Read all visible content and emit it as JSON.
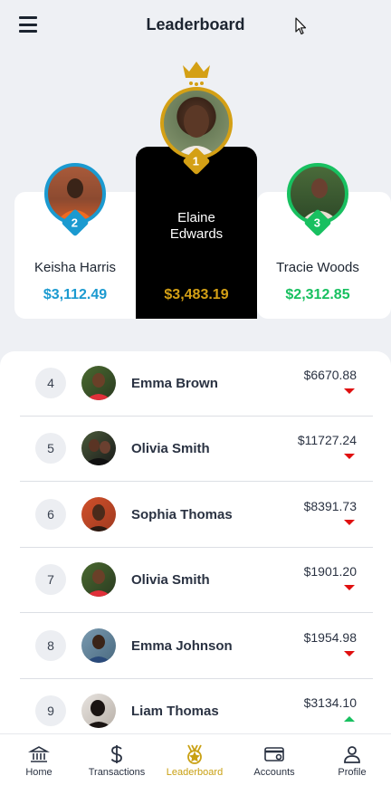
{
  "header": {
    "title": "Leaderboard"
  },
  "podium": {
    "first": {
      "rank": "1",
      "name_line1": "Elaine",
      "name_line2": "Edwards",
      "amount": "$3,483.19",
      "color": "#d4a015"
    },
    "second": {
      "rank": "2",
      "name": "Keisha Harris",
      "amount": "$3,112.49",
      "color": "#1b9ad0"
    },
    "third": {
      "rank": "3",
      "name": "Tracie Woods",
      "amount": "$2,312.85",
      "color": "#18c060"
    }
  },
  "list": [
    {
      "rank": "4",
      "name": "Emma Brown",
      "amount": "$6670.88",
      "trend": "down"
    },
    {
      "rank": "5",
      "name": "Olivia Smith",
      "amount": "$11727.24",
      "trend": "down"
    },
    {
      "rank": "6",
      "name": "Sophia Thomas",
      "amount": "$8391.73",
      "trend": "down"
    },
    {
      "rank": "7",
      "name": "Olivia Smith",
      "amount": "$1901.20",
      "trend": "down"
    },
    {
      "rank": "8",
      "name": "Emma Johnson",
      "amount": "$1954.98",
      "trend": "down"
    },
    {
      "rank": "9",
      "name": "Liam Thomas",
      "amount": "$3134.10",
      "trend": "up"
    }
  ],
  "nav": [
    {
      "label": "Home",
      "icon": "bank-icon"
    },
    {
      "label": "Transactions",
      "icon": "dollar-icon"
    },
    {
      "label": "Leaderboard",
      "icon": "medal-icon",
      "active": true
    },
    {
      "label": "Accounts",
      "icon": "card-icon"
    },
    {
      "label": "Profile",
      "icon": "person-icon"
    }
  ],
  "colors": {
    "accent_gold": "#c9a012",
    "down": "#e01010",
    "up": "#18c060"
  }
}
